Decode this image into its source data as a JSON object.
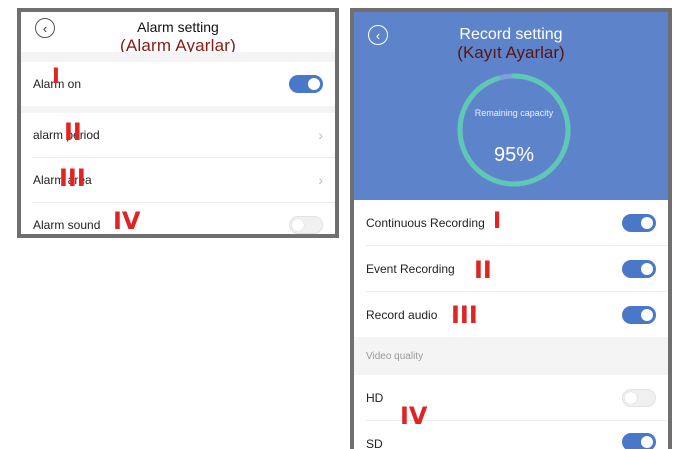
{
  "alarm_panel": {
    "title": "Alarm setting",
    "translation": "(Alarm Ayarlar)",
    "rows": [
      {
        "label": "Alarm on",
        "marker": "I",
        "control": "toggle",
        "enabled": true
      },
      {
        "label": "alarm period",
        "marker": "II",
        "control": "chevron"
      },
      {
        "label": "Alarm area",
        "marker": "III",
        "control": "chevron"
      },
      {
        "label": "Alarm sound",
        "marker": "IV",
        "control": "toggle",
        "enabled": false
      }
    ]
  },
  "record_panel": {
    "title": "Record setting",
    "translation": "(Kayıt Ayarlar)",
    "capacity": {
      "label": "Remaining capacity",
      "percent_text": "95%",
      "fraction": 0.95
    },
    "rows": [
      {
        "label": "Continuous Recording",
        "marker": "I",
        "enabled": true
      },
      {
        "label": "Event Recording",
        "marker": "II",
        "enabled": true
      },
      {
        "label": "Record audio",
        "marker": "III",
        "enabled": true
      }
    ],
    "video_quality": {
      "section_label": "Video quality",
      "marker": "IV",
      "options": [
        {
          "label": "HD",
          "enabled": false
        },
        {
          "label": "SD",
          "enabled": true
        }
      ]
    }
  },
  "colors": {
    "header_blue": "#5d84cb",
    "toggle_on": "#4a78c9",
    "ring": "#5ec8b5",
    "marker_red": "#e02323",
    "translation_red": "#8a1a12"
  },
  "icons": {
    "back": "chevron-left-icon",
    "disclosure": "chevron-right-icon"
  }
}
